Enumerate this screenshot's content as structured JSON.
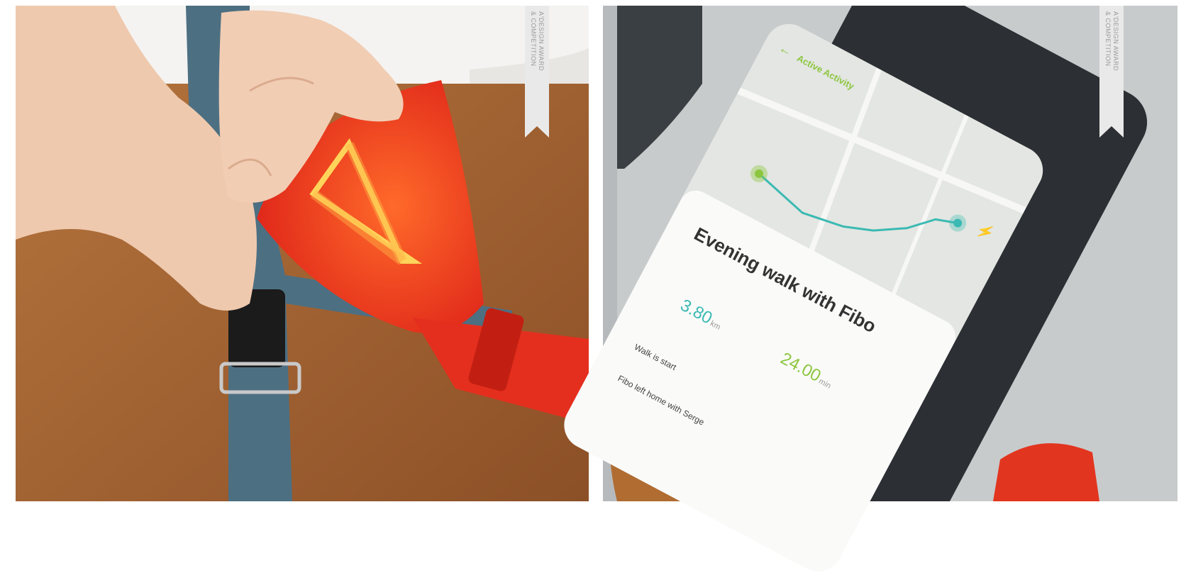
{
  "award_badge": {
    "lines": "A'DESIGN AWARD\n& COMPETITION"
  },
  "phone_app": {
    "header_title": "Active Activity",
    "walk_title": "Evening walk with Fibo",
    "subtitle": "",
    "distance_value": "3.80",
    "distance_unit": "km",
    "time_value": "24.00",
    "time_unit": "min",
    "timeline": [
      {
        "time": "",
        "text": "Walk is start"
      },
      {
        "time": "",
        "text": "Fibo left home with Serge"
      }
    ]
  },
  "colors": {
    "accent_green": "#8cc63f",
    "route_teal": "#3bb9b3",
    "harness_red": "#e6331f",
    "harness_blue": "#4d6f82",
    "dog_fur": "#a8683a"
  }
}
